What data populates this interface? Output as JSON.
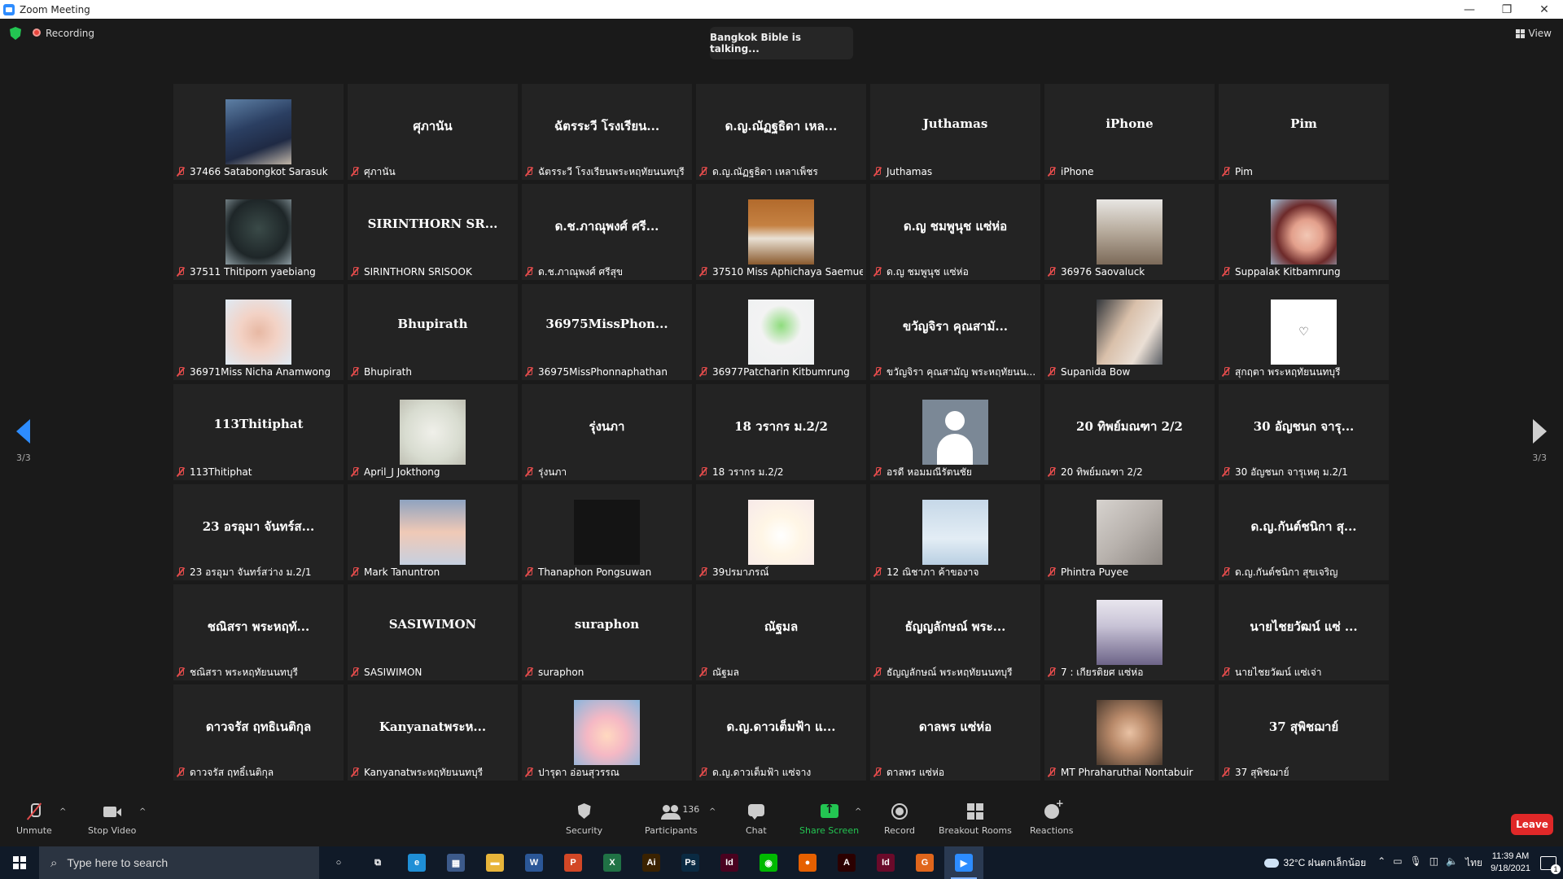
{
  "window": {
    "title": "Zoom Meeting",
    "controls": [
      "—",
      "❐",
      "✕"
    ]
  },
  "topbar": {
    "recording_label": "Recording",
    "talking": "Bangkok Bible is talking...",
    "view_label": "View"
  },
  "pagination": {
    "left": "3/3",
    "right": "3/3"
  },
  "tiles": [
    {
      "big": "",
      "label": "37466 Satabongkot Sarasuk",
      "pic": "p-officer"
    },
    {
      "big": "ศุภานัน",
      "label": "ศุภานัน",
      "pic": ""
    },
    {
      "big": "ฉัตรระวี โรงเรียน...",
      "label": "ฉัตรระวี โรงเรียนพระหฤทัยนนทบุรี",
      "pic": ""
    },
    {
      "big": "ด.ญ.ณัฏฐธิดา เหล...",
      "label": "ด.ญ.ณัฏฐธิดา เหลาเพ็ชร",
      "pic": ""
    },
    {
      "big": "Juthamas",
      "label": "Juthamas",
      "pic": ""
    },
    {
      "big": "iPhone",
      "label": "iPhone",
      "pic": ""
    },
    {
      "big": "Pim",
      "label": "Pim",
      "pic": ""
    },
    {
      "big": "",
      "label": "37511 Thitiporn yaebiang",
      "pic": "p-cat"
    },
    {
      "big": "SIRINTHORN SR...",
      "label": "SIRINTHORN SRISOOK",
      "pic": ""
    },
    {
      "big": "ด.ช.ภาณุพงศ์ ศรี...",
      "label": "ด.ช.ภาณุพงศ์ ศรีสุข",
      "pic": ""
    },
    {
      "big": "",
      "label": "37510 Miss Aphichaya Saemue",
      "pic": "p-autumn"
    },
    {
      "big": "ด.ญ ชมพูนุช แซ่ห่อ",
      "label": "ด.ญ ชมพูนุช แซ่ห่อ",
      "pic": ""
    },
    {
      "big": "",
      "label": "36976 Saovaluck",
      "pic": "p-kitten"
    },
    {
      "big": "",
      "label": "Suppalak Kitbamrung",
      "pic": "p-princess"
    },
    {
      "big": "",
      "label": "36971Miss Nicha Anamwong",
      "pic": "p-bear"
    },
    {
      "big": "Bhupirath",
      "label": "Bhupirath",
      "pic": ""
    },
    {
      "big": "36975MissPhon...",
      "label": "36975MissPhonnaphathan",
      "pic": ""
    },
    {
      "big": "",
      "label": "36977Patcharin Kitbumrung",
      "pic": "p-catglasses"
    },
    {
      "big": "ขวัญจิรา คุณสามั...",
      "label": "ขวัญจิรา คุณสามัญ พระหฤทัยนน...",
      "pic": ""
    },
    {
      "big": "",
      "label": "Supanida Bow",
      "pic": "p-family"
    },
    {
      "big": "",
      "label": "สุกฤตา พระหฤทัยนนทบุรี",
      "pic": "p-heart",
      "glyph": "♡"
    },
    {
      "big": "113Thitiphat",
      "label": "113Thitiphat",
      "pic": ""
    },
    {
      "big": "",
      "label": "April_J Jokthong",
      "pic": "p-sketch"
    },
    {
      "big": "รุ่งนภา",
      "label": "รุ่งนภา",
      "pic": ""
    },
    {
      "big": "18 วรากร ม.2/2",
      "label": "18 วรากร ม.2/2",
      "pic": ""
    },
    {
      "big": "",
      "label": "อรดี หอมมณีรัตนชัย",
      "pic": "p-avatar"
    },
    {
      "big": "20 ทิพย์มณฑา 2/2",
      "label": "20 ทิพย์มณฑา 2/2",
      "pic": ""
    },
    {
      "big": "30 อัญชนก จารุ...",
      "label": "30 อัญชนก จารุเหตุ ม.2/1",
      "pic": ""
    },
    {
      "big": "23 อรอุมา จันทร์ส...",
      "label": "23 อรอุมา จันทร์สว่าง ม.2/1",
      "pic": ""
    },
    {
      "big": "",
      "label": "Mark Tanuntron",
      "pic": "p-sky"
    },
    {
      "big": "",
      "label": "Thanaphon Pongsuwan",
      "pic": "p-dark"
    },
    {
      "big": "",
      "label": "39ปรมาภรณ์",
      "pic": "p-chick"
    },
    {
      "big": "",
      "label": "12 ณิชาภา ค้าของาจ",
      "pic": "p-sky2"
    },
    {
      "big": "",
      "label": "Phintra Puyee",
      "pic": "p-fabric"
    },
    {
      "big": "ด.ญ.กันต์ชนิกา สุ...",
      "label": "ด.ญ.กันต์ชนิกา สุขเจริญ",
      "pic": ""
    },
    {
      "big": "ชณิสรา พระหฤทั...",
      "label": "ชณิสรา พระหฤทัยนนทบุรี",
      "pic": ""
    },
    {
      "big": "SASIWIMON",
      "label": "SASIWIMON",
      "pic": ""
    },
    {
      "big": "suraphon",
      "label": "suraphon",
      "pic": ""
    },
    {
      "big": "ณัฐมล",
      "label": "ณัฐมล",
      "pic": ""
    },
    {
      "big": "ธัญญลักษณ์ พระ...",
      "label": "ธัญญลักษณ์ พระหฤทัยนนทบุรี",
      "pic": ""
    },
    {
      "big": "",
      "label": "7 : เกียรติยศ แซ่ห่อ",
      "pic": "p-anime"
    },
    {
      "big": "นายไชยวัฒน์ แซ่ ...",
      "label": "นายไชยวัฒน์ แซ่เจ่า",
      "pic": ""
    },
    {
      "big": "ดาวจรัส ฤทธิเนติกุล",
      "label": "ดาวจรัส ฤทธิ์เนติกุล",
      "pic": ""
    },
    {
      "big": "Kanyanatพระห...",
      "label": "Kanyanatพระหฤทัยนนทบุรี",
      "pic": ""
    },
    {
      "big": "",
      "label": "ปารุดา อ่อนสุวรรณ",
      "pic": "p-shin"
    },
    {
      "big": "ด.ญ.ดาวเต็มฟ้า แ...",
      "label": "ด.ญ.ดาวเต็มฟ้า แซ่จาง",
      "pic": ""
    },
    {
      "big": "ดาลพร แซ่ห่อ",
      "label": "ดาลพร แซ่ห่อ",
      "pic": ""
    },
    {
      "big": "",
      "label": "MT Phraharuthai Nontabuir",
      "pic": "p-baby"
    },
    {
      "big": "37 สุพิชฌาย์",
      "label": "37 สุพิชฌาย์",
      "pic": ""
    }
  ],
  "toolbar": {
    "unmute": "Unmute",
    "stop_video": "Stop Video",
    "security": "Security",
    "participants": "Participants",
    "participants_count": "136",
    "chat": "Chat",
    "share_screen": "Share Screen",
    "record": "Record",
    "breakout_rooms": "Breakout Rooms",
    "reactions": "Reactions",
    "leave": "Leave"
  },
  "taskbar": {
    "search_placeholder": "Type here to search",
    "apps": [
      {
        "name": "cortana-icon",
        "glyph": "○",
        "color": "transparent"
      },
      {
        "name": "task-view-icon",
        "glyph": "⧉",
        "color": "transparent"
      },
      {
        "name": "edge-icon",
        "glyph": "e",
        "color": "#1f8fd6"
      },
      {
        "name": "calculator-icon",
        "glyph": "▦",
        "color": "#3c5a8a"
      },
      {
        "name": "file-explorer-icon",
        "glyph": "▬",
        "color": "#e8b53a"
      },
      {
        "name": "word-icon",
        "glyph": "W",
        "color": "#2b5797"
      },
      {
        "name": "powerpoint-icon",
        "glyph": "P",
        "color": "#d24726"
      },
      {
        "name": "excel-icon",
        "glyph": "X",
        "color": "#207245"
      },
      {
        "name": "illustrator-icon",
        "glyph": "Ai",
        "color": "#3a2200"
      },
      {
        "name": "photoshop-icon",
        "glyph": "Ps",
        "color": "#0a2a42"
      },
      {
        "name": "indesign-icon",
        "glyph": "Id",
        "color": "#49021f"
      },
      {
        "name": "line-icon",
        "glyph": "◉",
        "color": "#00b900"
      },
      {
        "name": "firefox-icon",
        "glyph": "●",
        "color": "#e66000"
      },
      {
        "name": "acrobat-icon",
        "glyph": "A",
        "color": "#2b0000"
      },
      {
        "name": "indesign2-icon",
        "glyph": "Id",
        "color": "#6a0a2a"
      },
      {
        "name": "grammarly-icon",
        "glyph": "G",
        "color": "#e0661c"
      },
      {
        "name": "zoom-icon",
        "glyph": "▶",
        "color": "#2d8cff",
        "active": true
      }
    ],
    "weather": "32°C  ฝนตกเล็กน้อย",
    "language": "ไทย",
    "time": "11:39 AM",
    "date": "9/18/2021",
    "notifications": "1"
  }
}
